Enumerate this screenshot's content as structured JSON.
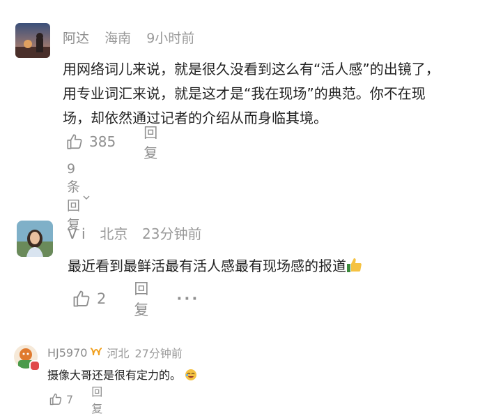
{
  "comments": [
    {
      "username": "阿达",
      "location": "海南",
      "time": "9小时前",
      "lines": [
        "用网络词儿来说，就是很久没看到这么有“活人感”的出镜了，",
        "用专业词汇来说，就是这才是“我在现场”的典范。你不在现",
        "场，却依然通过记者的介绍从而身临其境。"
      ],
      "likes": "385",
      "reply_label": "回复",
      "replies_label": "9条回复",
      "avatar": "landscape-avatar"
    },
    {
      "username": "V i",
      "location": "北京",
      "time": "23分钟前",
      "text": "最近看到最鲜活最有活人感最有现场感的报道",
      "emoji": "thumbs-up-emoji",
      "likes": "2",
      "reply_label": "回复",
      "more_label": "···",
      "avatar": "woman-portrait-avatar"
    },
    {
      "username": "HJ5970",
      "badge": "gold-member-badge",
      "location": "河北",
      "time": "27分钟前",
      "text": "摄像大哥还是很有定力的。",
      "emoji": "laughing-emoji",
      "likes": "7",
      "reply_label": "回复",
      "avatar": "cartoon-avatar"
    }
  ],
  "colors": {
    "meta_gray": "#999999",
    "text": "#222222",
    "action_gray": "#8f8f8f",
    "badge_orange": "#f0a020"
  }
}
